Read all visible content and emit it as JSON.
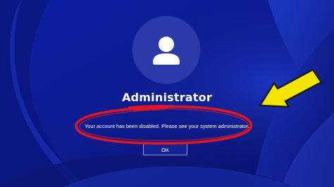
{
  "screen": {
    "username": "Administrator",
    "message": "Your account has been disabled. Please see your system administrator.",
    "ok_label": "OK",
    "avatar_icon": "user-icon"
  },
  "annotations": {
    "highlight_color": "#e01624",
    "arrow_color": "#f2e600"
  },
  "colors": {
    "background": "#0b1a86",
    "text": "#ffffff"
  }
}
